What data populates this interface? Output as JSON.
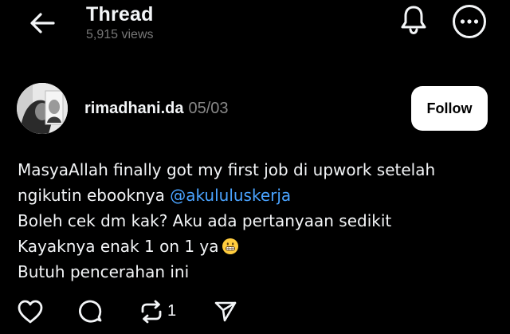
{
  "header": {
    "title": "Thread",
    "views": "5,915 views",
    "icons": {
      "back": "back-arrow-icon",
      "bell": "bell-icon",
      "more": "more-options-icon"
    }
  },
  "post": {
    "username": "rimadhani.da",
    "date": "05/03",
    "follow_label": "Follow",
    "lines": {
      "l1": "MasyaAllah finally got my first job di upwork setelah",
      "l2_prefix": "ngikutin ebooknya ",
      "mention": "@akululuskerja",
      "l3": "Boleh cek dm kak? Aku ada pertanyaan sedikit",
      "l4": "Kayaknya enak 1 on 1 ya",
      "l5": "Butuh pencerahan ini"
    },
    "emoji": "grinning-face-emoji"
  },
  "actions": {
    "repost_count": "1",
    "icons": [
      "heart-icon",
      "comment-icon",
      "repost-icon",
      "share-icon"
    ]
  },
  "colors": {
    "background": "#000000",
    "text": "#f3f5f7",
    "muted": "#777777",
    "mention": "#4aa3ff",
    "follow_bg": "#ffffff"
  }
}
